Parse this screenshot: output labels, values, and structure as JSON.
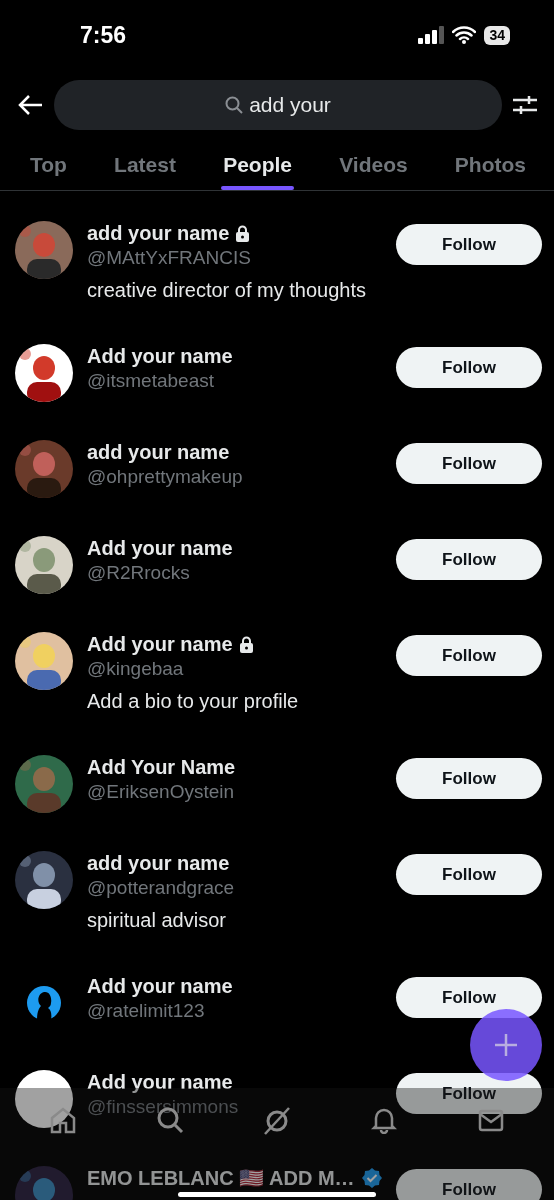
{
  "status_bar": {
    "time": "7:56",
    "battery": "34"
  },
  "search": {
    "value": "add your"
  },
  "tabs": [
    {
      "label": "Top",
      "selected": false
    },
    {
      "label": "Latest",
      "selected": false
    },
    {
      "label": "People",
      "selected": true
    },
    {
      "label": "Videos",
      "selected": false
    },
    {
      "label": "Photos",
      "selected": false
    }
  ],
  "people": [
    {
      "name": "add your name",
      "locked": true,
      "verified": false,
      "handle": "@MAttYxFRANCIS",
      "bio": "creative director of my thoughts",
      "button": "Follow"
    },
    {
      "name": "Add your name",
      "locked": false,
      "verified": false,
      "handle": "@itsmetabeast",
      "button": "Follow"
    },
    {
      "name": "add your name",
      "locked": false,
      "verified": false,
      "handle": "@ohprettymakeup",
      "button": "Follow"
    },
    {
      "name": "Add your name",
      "locked": false,
      "verified": false,
      "handle": "@R2Rrocks",
      "button": "Follow"
    },
    {
      "name": "Add your name",
      "locked": true,
      "verified": false,
      "handle": "@kingebaa",
      "bio": "Add a bio to your profile",
      "button": "Follow"
    },
    {
      "name": "Add Your Name",
      "locked": false,
      "verified": false,
      "handle": "@EriksenOystein",
      "button": "Follow"
    },
    {
      "name": "add your name",
      "locked": false,
      "verified": false,
      "handle": "@potterandgrace",
      "bio": "spiritual advisor",
      "button": "Follow"
    },
    {
      "name": "Add your name",
      "locked": false,
      "verified": false,
      "handle": "@ratelimit123",
      "avatar": {
        "kind": "silhouette"
      },
      "button": "Follow"
    },
    {
      "name": "Add your name",
      "locked": false,
      "verified": false,
      "handle": "@finssersimmons",
      "avatar": {
        "kind": "blank"
      },
      "button": "Follow"
    },
    {
      "name": "EMO LEBLANC 🇺🇸 ADD M…",
      "locked": false,
      "verified": true,
      "button": "Follow"
    }
  ]
}
